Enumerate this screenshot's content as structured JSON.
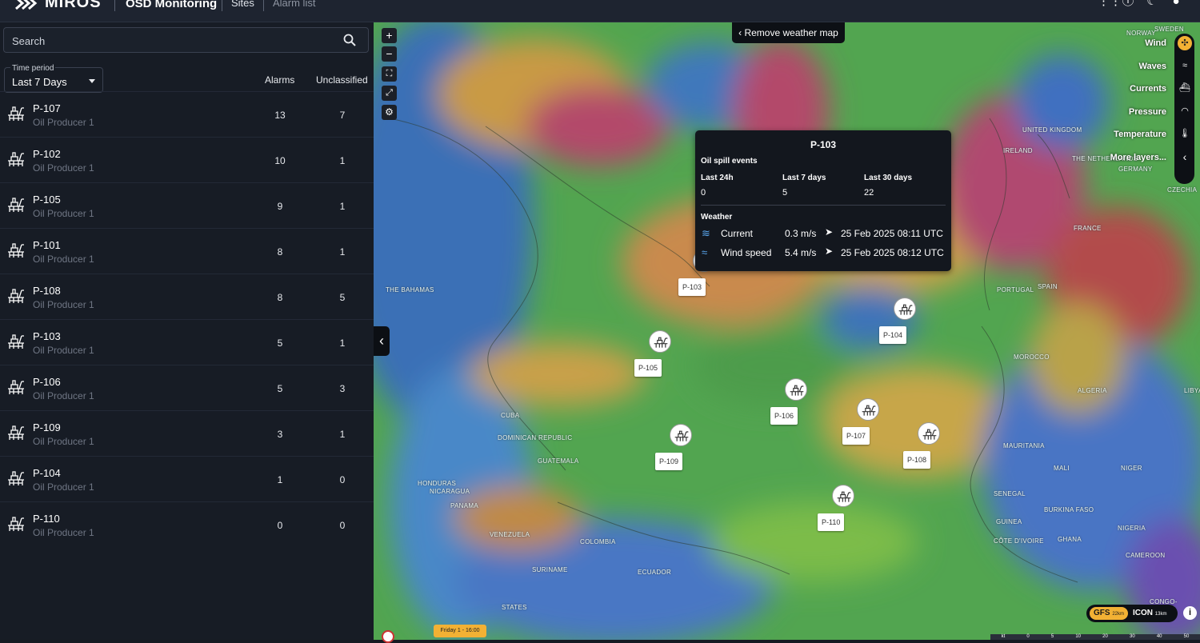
{
  "app": {
    "brand": "MIROS",
    "title": "OSD Monitoring",
    "nav": [
      "Sites",
      "Alarm list"
    ]
  },
  "sidebar": {
    "search": {
      "label": "Search"
    },
    "time_period": {
      "legend": "Time period",
      "value": "Last 7 Days"
    },
    "columns": {
      "alarms": "Alarms",
      "unclassified": "Unclassified"
    },
    "sites": [
      {
        "name": "P-107",
        "type": "Oil Producer 1",
        "alarms": "13",
        "unclassified": "7"
      },
      {
        "name": "P-102",
        "type": "Oil Producer 1",
        "alarms": "10",
        "unclassified": "1"
      },
      {
        "name": "P-105",
        "type": "Oil Producer 1",
        "alarms": "9",
        "unclassified": "1"
      },
      {
        "name": "P-101",
        "type": "Oil Producer 1",
        "alarms": "8",
        "unclassified": "1"
      },
      {
        "name": "P-108",
        "type": "Oil Producer 1",
        "alarms": "8",
        "unclassified": "5"
      },
      {
        "name": "P-103",
        "type": "Oil Producer 1",
        "alarms": "5",
        "unclassified": "1"
      },
      {
        "name": "P-106",
        "type": "Oil Producer 1",
        "alarms": "5",
        "unclassified": "3"
      },
      {
        "name": "P-109",
        "type": "Oil Producer 1",
        "alarms": "3",
        "unclassified": "1"
      },
      {
        "name": "P-104",
        "type": "Oil Producer 1",
        "alarms": "1",
        "unclassified": "0"
      },
      {
        "name": "P-110",
        "type": "Oil Producer 1",
        "alarms": "0",
        "unclassified": "0"
      }
    ]
  },
  "map": {
    "remove_weather": "Remove weather map",
    "layers": [
      "Wind",
      "Waves",
      "Currents",
      "Pressure",
      "Temperature",
      "More layers..."
    ],
    "tooltip": {
      "site": "P-103",
      "oil_heading": "Oil spill events",
      "periods": [
        {
          "label": "Last 24h",
          "value": "0"
        },
        {
          "label": "Last 7 days",
          "value": "5"
        },
        {
          "label": "Last 30 days",
          "value": "22"
        }
      ],
      "weather_heading": "Weather",
      "current": {
        "label": "Current",
        "value": "0.3 m/s",
        "time": "25 Feb 2025 08:11 UTC"
      },
      "wind": {
        "label": "Wind speed",
        "value": "5.4 m/s",
        "time": "25 Feb 2025 08:12 UTC"
      }
    },
    "markers": [
      "P-103",
      "P-104",
      "P-105",
      "P-106",
      "P-107",
      "P-108",
      "P-109",
      "P-110"
    ],
    "places": [
      "NORWAY",
      "SWEDEN",
      "UNITED KINGDOM",
      "IRELAND",
      "THE NETHERLANDS",
      "GERMANY",
      "CZECHIA",
      "FRANCE",
      "PORTUGAL",
      "SPAIN",
      "MOROCCO",
      "ALGERIA",
      "LIBYA",
      "MAURITANIA",
      "MALI",
      "NIGER",
      "SENEGAL",
      "BURKINA FASO",
      "GUINEA",
      "NIGERIA",
      "GHANA",
      "CÔTE D'IVOIRE",
      "CAMEROON",
      "THE BAHAMAS",
      "CUBA",
      "DOMINICAN REPUBLIC",
      "GUATEMALA",
      "HONDURAS",
      "NICARAGUA",
      "PANAMA",
      "VENEZUELA",
      "COLOMBIA",
      "SURINAME",
      "ECUADOR",
      "STATES",
      "CONGO-BRAZZA"
    ],
    "model": {
      "gfs": "GFS",
      "gfs_res": "22km",
      "icon": "ICON",
      "icon_res": "13km"
    },
    "timeline": "Friday 1 - 16:00",
    "scale": [
      "kt",
      "0",
      "5",
      "10",
      "20",
      "30",
      "40",
      "50"
    ]
  }
}
